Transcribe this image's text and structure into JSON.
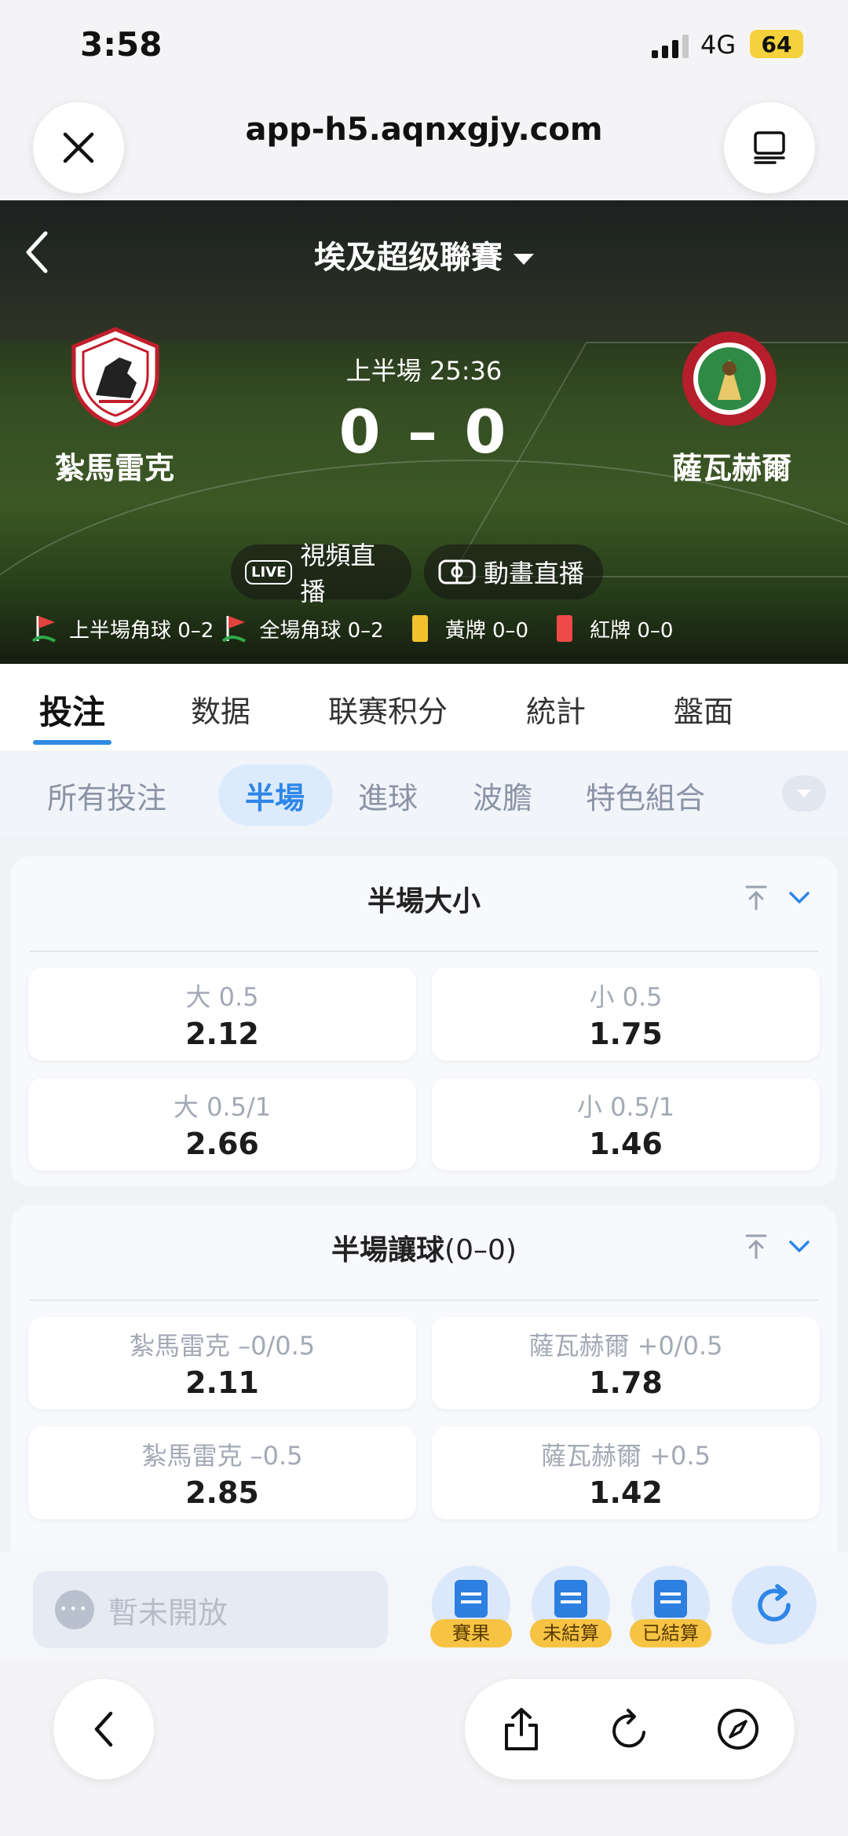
{
  "status": {
    "time": "3:58",
    "network": "4G",
    "battery": "64"
  },
  "browser": {
    "url": "app-h5.aqnxgjy.com"
  },
  "match": {
    "league": "埃及超级聯賽",
    "home_team": "紮馬雷克",
    "away_team": "薩瓦赫爾",
    "period": "上半場 25:36",
    "score": "0 – 0",
    "video_live": "視頻直播",
    "animation_live": "動畫直播",
    "live_badge": "LIVE",
    "stats": {
      "half_corners": "上半場角球 0–2",
      "full_corners": "全場角球 0–2",
      "yellow": "黃牌 0–0",
      "red": "紅牌 0–0"
    }
  },
  "main_tabs": [
    "投注",
    "数据",
    "联赛积分",
    "統計",
    "盤面"
  ],
  "sub_tabs": [
    "所有投注",
    "半場",
    "進球",
    "波膽",
    "特色組合"
  ],
  "markets": [
    {
      "title": "半場大小",
      "subtitle": "",
      "odds": [
        {
          "label": "大 0.5",
          "value": "2.12"
        },
        {
          "label": "小 0.5",
          "value": "1.75"
        },
        {
          "label": "大 0.5/1",
          "value": "2.66"
        },
        {
          "label": "小 0.5/1",
          "value": "1.46"
        }
      ]
    },
    {
      "title": "半場讓球",
      "subtitle": "(0–0)",
      "odds": [
        {
          "label": "紮馬雷克 –0/0.5",
          "value": "2.11"
        },
        {
          "label": "薩瓦赫爾 +0/0.5",
          "value": "1.78"
        },
        {
          "label": "紮馬雷克 –0.5",
          "value": "2.85"
        },
        {
          "label": "薩瓦赫爾 +0.5",
          "value": "1.42"
        }
      ]
    }
  ],
  "bottom_bar": {
    "chat_placeholder": "暫未開放",
    "results": "賽果",
    "unsettled": "未結算",
    "settled": "已結算"
  },
  "colors": {
    "accent": "#2e86e8",
    "tag": "#f6c343",
    "yellow_card": "#f2c12e",
    "red_card": "#f0494a"
  }
}
